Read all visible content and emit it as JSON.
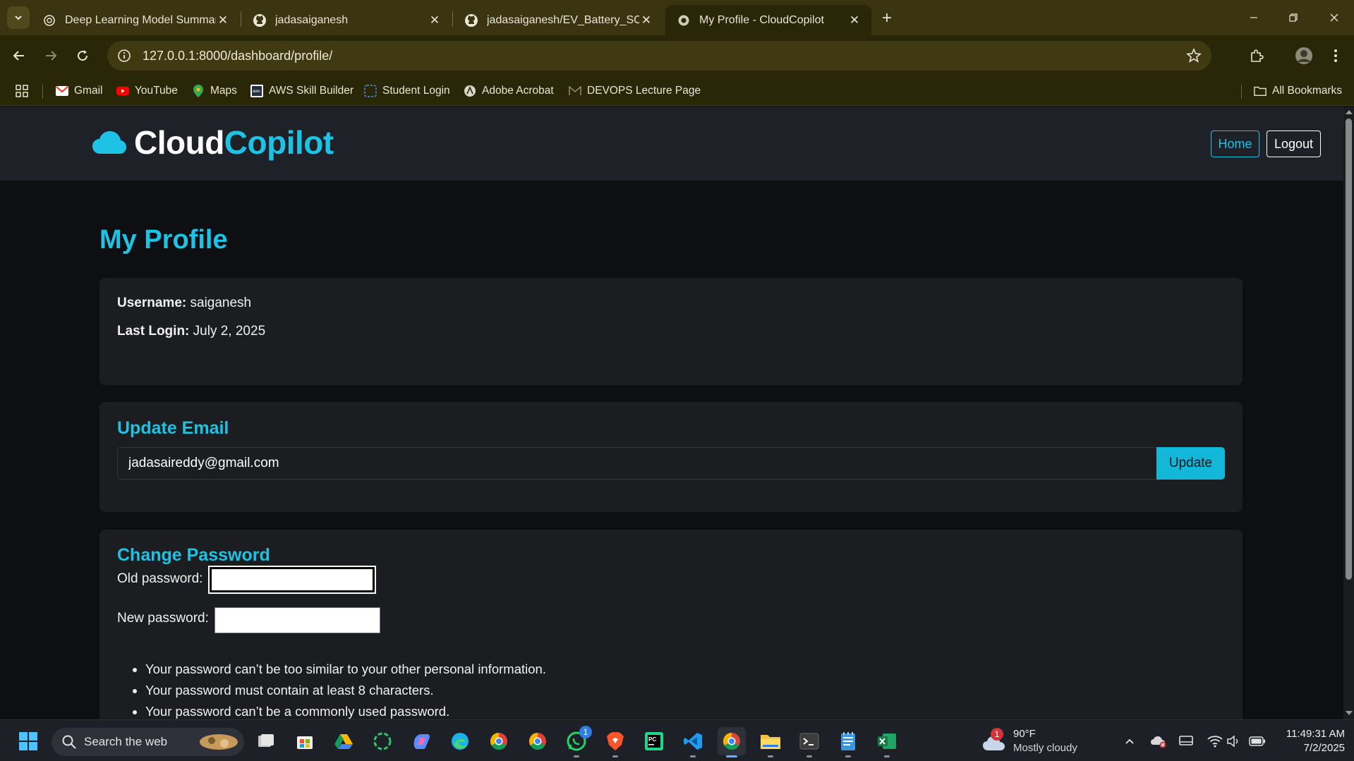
{
  "browser": {
    "tabs": [
      {
        "title": "Deep Learning Model Summary",
        "icon": "chatgpt-icon"
      },
      {
        "title": "jadasaiganesh",
        "icon": "github-icon"
      },
      {
        "title": "jadasaiganesh/EV_Battery_SOH",
        "icon": "github-icon"
      },
      {
        "title": "My Profile - CloudCopilot",
        "icon": "globe-icon",
        "active": true
      }
    ],
    "url": "127.0.0.1:8000/dashboard/profile/",
    "bookmarks": [
      {
        "label": "Gmail",
        "icon": "gmail-icon"
      },
      {
        "label": "YouTube",
        "icon": "youtube-icon"
      },
      {
        "label": "Maps",
        "icon": "maps-icon"
      },
      {
        "label": "AWS Skill Builder",
        "icon": "aws-icon"
      },
      {
        "label": "Student Login",
        "icon": "student-login-icon"
      },
      {
        "label": "Adobe Acrobat",
        "icon": "acrobat-icon"
      },
      {
        "label": "DEVOPS Lecture Page",
        "icon": "gmail-outline-icon"
      }
    ],
    "all_bookmarks": "All Bookmarks"
  },
  "site": {
    "brand_part1": "Cloud",
    "brand_part2": "Copilot",
    "nav": {
      "home": "Home",
      "logout": "Logout"
    },
    "colors": {
      "accent": "#1dc2e4",
      "navbar": "#1e2228",
      "card": "#1c1d20"
    }
  },
  "profile": {
    "page_title": "My Profile",
    "username_label": "Username:",
    "username": "saiganesh",
    "last_login_label": "Last Login:",
    "last_login": "July 2, 2025"
  },
  "update_email": {
    "heading": "Update Email",
    "email_value": "jadasaireddy@gmail.com",
    "button": "Update"
  },
  "change_password": {
    "heading": "Change Password",
    "old_label": "Old password:",
    "new_label": "New password:",
    "hints": [
      "Your password can’t be too similar to your other personal information.",
      "Your password must contain at least 8 characters.",
      "Your password can’t be a commonly used password."
    ]
  },
  "taskbar": {
    "search_placeholder": "Search the web",
    "whatsapp_badge": "1",
    "weather_badge": "1",
    "temperature": "90°F",
    "condition": "Mostly cloudy",
    "time": "11:49:31 AM",
    "date": "7/2/2025"
  }
}
